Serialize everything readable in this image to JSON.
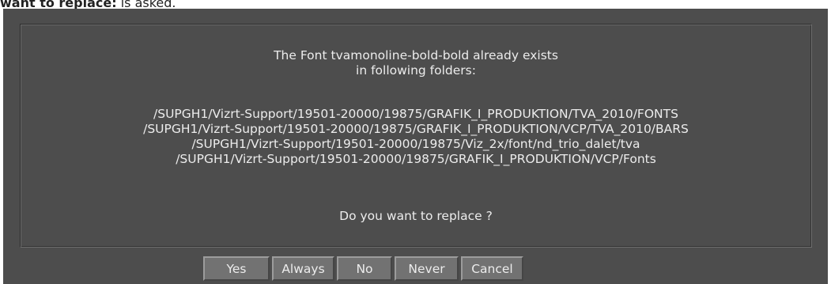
{
  "caption": {
    "bold": "want to replace:",
    "rest": " is asked."
  },
  "dialog": {
    "message_lines": [
      "The Font tvamonoline-bold-bold already exists",
      "in following folders:"
    ],
    "paths": [
      "/SUPGH1/Vizrt-Support/19501-20000/19875/GRAFIK_I_PRODUKTION/TVA_2010/FONTS",
      "/SUPGH1/Vizrt-Support/19501-20000/19875/GRAFIK_I_PRODUKTION/VCP/TVA_2010/BARS",
      "/SUPGH1/Vizrt-Support/19501-20000/19875/Viz_2x/font/nd_trio_dalet/tva",
      "/SUPGH1/Vizrt-Support/19501-20000/19875/GRAFIK_I_PRODUKTION/VCP/Fonts"
    ],
    "question": "Do you want to replace ?"
  },
  "buttons": {
    "yes": "Yes",
    "always": "Always",
    "no": "No",
    "never": "Never",
    "cancel": "Cancel"
  },
  "colors": {
    "dialog_background": "#4d4d4d",
    "button_face": "#727272",
    "text": "#ececec"
  }
}
